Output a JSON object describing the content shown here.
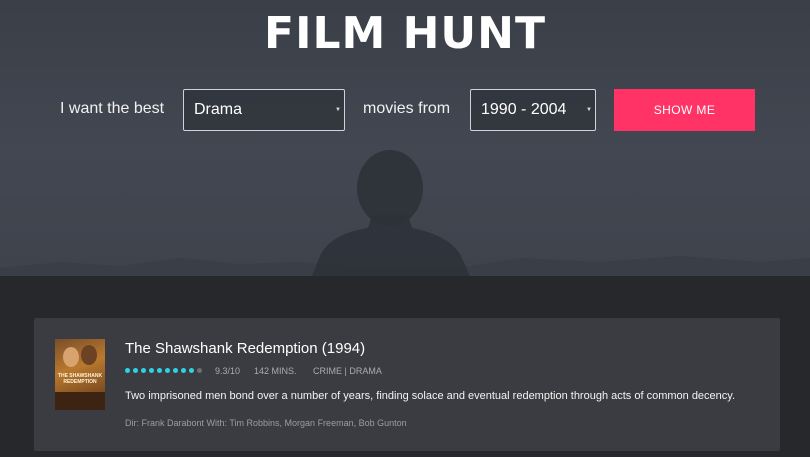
{
  "app": {
    "logo_text": "FILM HUNT"
  },
  "filters": {
    "prefix_label": "I want the best",
    "genre": {
      "selected": "Drama"
    },
    "middle_label": "movies from",
    "years": {
      "selected": "1990 - 2004"
    },
    "submit_label": "SHOW ME"
  },
  "movie": {
    "title": "The Shawshank Redemption (1994)",
    "poster_title": "THE SHAWSHANK REDEMPTION",
    "rating": {
      "value": 9.3,
      "max": 10,
      "text": "9.3/10",
      "filled_color": "#2fd3e0",
      "empty_color": "#6c6f75"
    },
    "runtime": "142 MINS.",
    "genres": "CRIME | DRAMA",
    "synopsis": "Two imprisoned men bond over a number of years, finding solace and eventual redemption through acts of common decency.",
    "credits": "Dir: Frank Darabont With: Tim Robbins, Morgan Freeman, Bob Gunton"
  },
  "colors": {
    "accent": "#ff3366",
    "hero_bg": "#3e434c",
    "page_bg": "#26282c",
    "card_bg": "#3a3c41"
  }
}
